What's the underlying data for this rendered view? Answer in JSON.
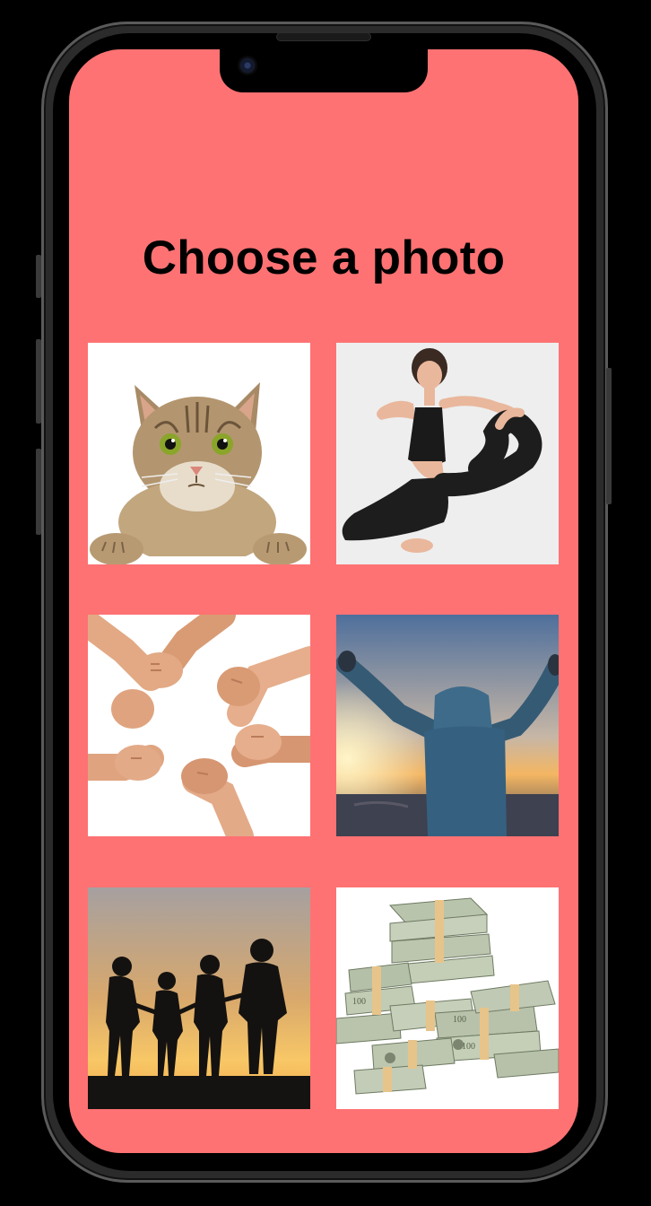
{
  "screen": {
    "title": "Choose a photo",
    "background_color": "#fe7273"
  },
  "photos": [
    {
      "subject": "cat",
      "icon": "cat-photo"
    },
    {
      "subject": "yoga woman",
      "icon": "yoga-photo"
    },
    {
      "subject": "linked hands",
      "icon": "hands-photo"
    },
    {
      "subject": "person celebrating at sunset",
      "icon": "sunset-celebration-photo"
    },
    {
      "subject": "family silhouette at sunset",
      "icon": "family-silhouette-photo"
    },
    {
      "subject": "stacks of money",
      "icon": "money-photo"
    }
  ]
}
